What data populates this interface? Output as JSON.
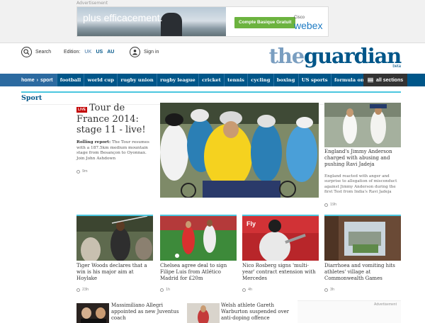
{
  "ad": {
    "label": "Advertisement",
    "slogan": "plus efficacement.",
    "cta": "Compte Basique Gratuit",
    "brand_small": "Cisco",
    "brand_large": "webex"
  },
  "header": {
    "search_label": "Search",
    "edition_label": "Edition:",
    "editions": [
      "UK",
      "US",
      "AU"
    ],
    "signin_label": "Sign in",
    "logo_the": "the",
    "logo_guardian": "guardian",
    "beta": "beta"
  },
  "nav": {
    "home": "home",
    "current": "sport",
    "links": [
      "football",
      "world cup",
      "rugby union",
      "rugby league",
      "cricket",
      "tennis",
      "cycling",
      "boxing",
      "US sports",
      "formula one"
    ],
    "all_sections": "all sections"
  },
  "section": {
    "title": "Sport"
  },
  "main_story": {
    "badge": "LIVE",
    "headline": "Tour de France 2014: stage 11 - live!",
    "kicker": "Rolling report:",
    "standfirst": "The Tour resumes with a 187.5km medium mountain stage from Besançon to Oyonnax. Join John Ashdown",
    "time": "9m"
  },
  "side_story": {
    "headline": "England's Jimmy Anderson charged with abusing and pushing Ravi Jadeja",
    "standfirst": "England reacted with anger and surprise to allegation of misconduct against Jimmy Anderson during the first Test from India's Ravi Jadeja",
    "time": "19h"
  },
  "cards": [
    {
      "headline": "Tiger Woods declares that a win is his major aim at Hoylake",
      "time": "23h"
    },
    {
      "headline": "Chelsea agree deal to sign Filipe Luis from Atlético Madrid for £20m",
      "time": "1h"
    },
    {
      "headline": "Nico Rosberg signs 'multi-year' contract extension with Mercedes",
      "time": "4h"
    },
    {
      "headline": "Diarrhoea and vomiting hits athletes' village at Commonwealth Games",
      "time": "3h"
    }
  ],
  "mini_cards": [
    {
      "headline": "Massimiliano Allegri appointed as new Juventus coach"
    },
    {
      "headline": "Welsh athlete Gareth Warburton suspended over anti-doping offence"
    }
  ],
  "right_ad_label": "Advertisement",
  "colors": {
    "brand": "#005689",
    "accent": "#4bc6df",
    "live": "#c30000"
  }
}
